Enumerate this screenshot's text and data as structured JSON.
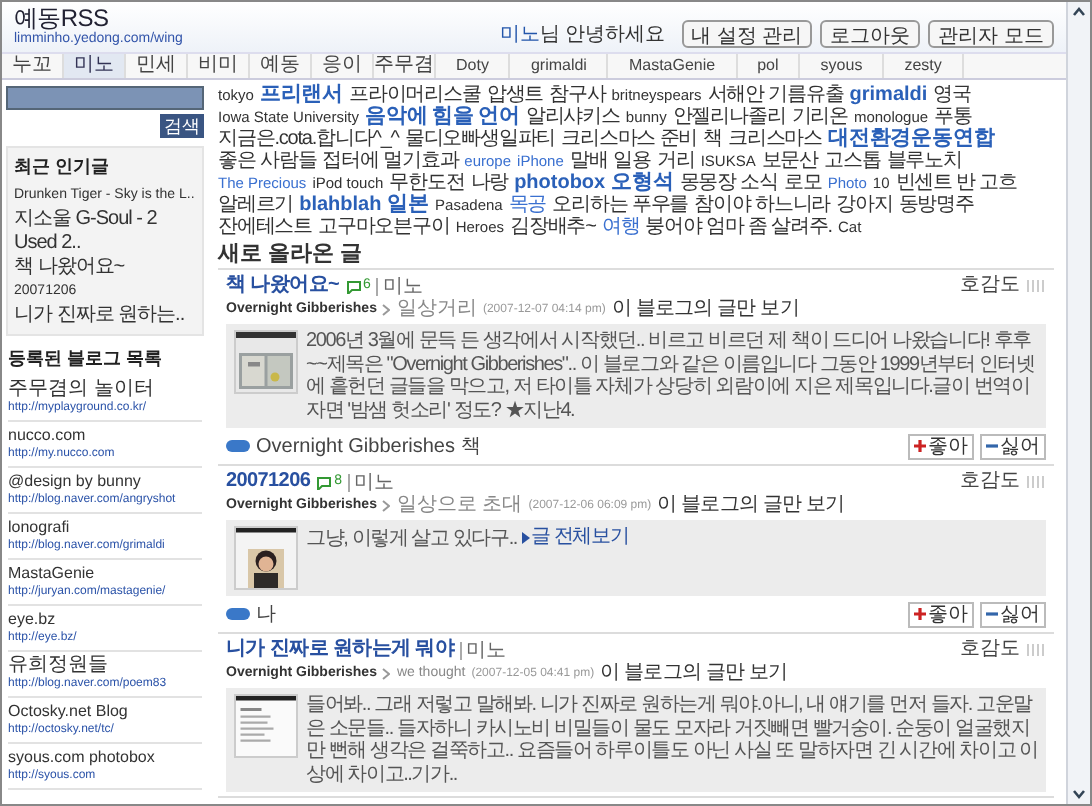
{
  "site": {
    "title": "예동RSS",
    "url": "limminho.yedong.com/wing"
  },
  "greeting": {
    "name": "미노",
    "text": "님 안녕하세요"
  },
  "header_buttons": [
    "내 설정 관리",
    "로그아웃",
    "관리자 모드"
  ],
  "tabs": [
    {
      "label": "누꼬",
      "selected": false
    },
    {
      "label": "미노",
      "selected": true
    },
    {
      "label": "민세",
      "selected": false
    },
    {
      "label": "비미",
      "selected": false
    },
    {
      "label": "예동",
      "selected": false
    },
    {
      "label": "응이",
      "selected": false
    },
    {
      "label": "주무겸",
      "selected": false
    },
    {
      "label": "Doty",
      "selected": false
    },
    {
      "label": "grimaldi",
      "selected": false
    },
    {
      "label": "MastaGenie",
      "selected": false
    },
    {
      "label": "pol",
      "selected": false
    },
    {
      "label": "syous",
      "selected": false
    },
    {
      "label": "zesty",
      "selected": false
    }
  ],
  "sidebar": {
    "search_button": "검색",
    "popular": {
      "title": "최근 인기글",
      "items": [
        "Drunken Tiger - Sky is the L..",
        "지소울 G-Soul - 2 Used 2..",
        "책 나왔어요~",
        "20071206",
        "니가 진짜로 원하는.."
      ]
    },
    "blogs": {
      "title": "등록된 블로그 목록",
      "items": [
        {
          "name": "주무겸의 놀이터",
          "url": "http://myplayground.co.kr/"
        },
        {
          "name": "nucco.com",
          "url": "http://my.nucco.com"
        },
        {
          "name": "@design by bunny",
          "url": "http://blog.naver.com/angryshot"
        },
        {
          "name": "lonografi",
          "url": "http://blog.naver.com/grimaldi"
        },
        {
          "name": "MastaGenie",
          "url": "http://juryan.com/mastagenie/"
        },
        {
          "name": "eye.bz",
          "url": "http://eye.bz/"
        },
        {
          "name": "유희정원들",
          "url": "http://blog.naver.com/poem83"
        },
        {
          "name": "Octosky.net Blog",
          "url": "http://octosky.net/tc/"
        },
        {
          "name": "syous.com photobox",
          "url": "http://syous.com"
        }
      ]
    }
  },
  "tags": [
    {
      "label": "tokyo",
      "kind": "plain"
    },
    {
      "label": "프리랜서",
      "kind": "big"
    },
    {
      "label": "프라이머리스쿨",
      "kind": "plain"
    },
    {
      "label": "압생트",
      "kind": "plain"
    },
    {
      "label": "참구사",
      "kind": "plain"
    },
    {
      "label": "britneyspears",
      "kind": "plain"
    },
    {
      "label": "서해안 기름유출",
      "kind": "plain"
    },
    {
      "label": "grimaldi",
      "kind": "big"
    },
    {
      "label": "영국",
      "kind": "plain"
    },
    {
      "label": "Iowa State University",
      "kind": "plain"
    },
    {
      "label": "음악에 힘을 언어",
      "kind": "big"
    },
    {
      "label": "알리샤키스",
      "kind": "plain"
    },
    {
      "label": "bunny",
      "kind": "plain"
    },
    {
      "label": "안젤리나졸리",
      "kind": "plain"
    },
    {
      "label": "기리온",
      "kind": "plain"
    },
    {
      "label": "monologue",
      "kind": "plain"
    },
    {
      "label": "푸통",
      "kind": "plain"
    },
    {
      "label": "지금은.cota.합니다^_^",
      "kind": "plain"
    },
    {
      "label": "물디오빠생일파티",
      "kind": "plain"
    },
    {
      "label": "크리스마스 준비",
      "kind": "plain"
    },
    {
      "label": "책",
      "kind": "plain"
    },
    {
      "label": "크리스마스",
      "kind": "plain"
    },
    {
      "label": "대전환경운동연합",
      "kind": "big"
    },
    {
      "label": "좋은 사람들",
      "kind": "plain"
    },
    {
      "label": "접터에 멀기효과",
      "kind": "plain"
    },
    {
      "label": "europe",
      "kind": "link"
    },
    {
      "label": "iPhone",
      "kind": "link"
    },
    {
      "label": "말배",
      "kind": "plain"
    },
    {
      "label": "일용",
      "kind": "plain"
    },
    {
      "label": "거리",
      "kind": "plain"
    },
    {
      "label": "ISUKSA",
      "kind": "plain"
    },
    {
      "label": "보문산",
      "kind": "plain"
    },
    {
      "label": "고스톱",
      "kind": "plain"
    },
    {
      "label": "블루노치",
      "kind": "plain"
    },
    {
      "label": "The Precious",
      "kind": "link"
    },
    {
      "label": "iPod touch",
      "kind": "plain"
    },
    {
      "label": "무한도전",
      "kind": "plain"
    },
    {
      "label": "나랑",
      "kind": "plain"
    },
    {
      "label": "photobox",
      "kind": "big"
    },
    {
      "label": "오형석",
      "kind": "big"
    },
    {
      "label": "몽몽장 소식",
      "kind": "plain"
    },
    {
      "label": "로모",
      "kind": "plain"
    },
    {
      "label": "Photo",
      "kind": "link"
    },
    {
      "label": "10",
      "kind": "plain"
    },
    {
      "label": "빈센트 반 고흐",
      "kind": "plain"
    },
    {
      "label": "알레르기",
      "kind": "plain"
    },
    {
      "label": "blahblah",
      "kind": "big"
    },
    {
      "label": "일본",
      "kind": "big"
    },
    {
      "label": "Pasadena",
      "kind": "plain"
    },
    {
      "label": "목공",
      "kind": "link"
    },
    {
      "label": "오리하는 푸우를",
      "kind": "plain"
    },
    {
      "label": "참이야 하느니라",
      "kind": "plain"
    },
    {
      "label": "강아지",
      "kind": "plain"
    },
    {
      "label": "동방명주",
      "kind": "plain"
    },
    {
      "label": "잔에테스트",
      "kind": "plain"
    },
    {
      "label": "고구마오븐구이",
      "kind": "plain"
    },
    {
      "label": "Heroes",
      "kind": "plain"
    },
    {
      "label": "김장배추~",
      "kind": "plain"
    },
    {
      "label": "여행",
      "kind": "link"
    },
    {
      "label": "붕어야 엄마 좀 살려주.",
      "kind": "plain"
    },
    {
      "label": "Cat",
      "kind": "plain"
    }
  ],
  "section_title": "새로 올라온 글",
  "posts": [
    {
      "title": "책 나왔어요~",
      "comments": "6",
      "author": "미노",
      "blog": "Overnight Gibberishes",
      "category": "일상거리",
      "date": "(2007-12-07 04:14 pm)",
      "filter_link": "이 블로그의 글만 보기",
      "rating_label": "호감도",
      "excerpt": "2006년 3월에 문득 든 생각에서 시작했던.. 비르고 비르던 제 책이 드디어 나왔습니다! 후후~~제목은 \"Overnight Gibberishes\".. 이 블로그와 같은 이름입니다 그동안 1999년부터 인터넷에 흩헌던 글들을 막으고, 저 타이틀 자체가 상당히 외람이에 지은 제목입니다.글이 번역이자면 '밤샘 헛소리' 정도? ★지난4.",
      "tags_text": "Overnight Gibberishes 책",
      "like": "좋아",
      "dislike": "싫어"
    },
    {
      "title": "20071206",
      "comments": "8",
      "author": "미노",
      "blog": "Overnight Gibberishes",
      "category": "일상으로 초대",
      "date": "(2007-12-06 06:09 pm)",
      "filter_link": "이 블로그의 글만 보기",
      "rating_label": "호감도",
      "excerpt": "그냥, 이렇게 살고 있다구..",
      "more_link": "글 전체보기",
      "tags_text": "나",
      "like": "좋아",
      "dislike": "싫어"
    },
    {
      "title": "니가 진짜로 원하는게 뭐야",
      "author": "미노",
      "blog": "Overnight Gibberishes",
      "category": "we thought",
      "date": "(2007-12-05 04:41 pm)",
      "filter_link": "이 블로그의 글만 보기",
      "rating_label": "호감도",
      "excerpt": "들어봐.. 그래 저렇고 말해봐. 니가 진짜로 원하는게 뭐야.아니, 내 얘기를 먼저 들자. 고운말은 소문들.. 들자하니 카시노비 비밀들이 물도 모자라 거짓빼면 빨거숭이. 순둥이 얼굴했지만 뻔해 생각은 걸쭉하고.. 요즘들어 하루이틀도 아닌 사실 또 말하자면 긴 시간에 차이고 이상에 차이고..기가.."
    }
  ]
}
